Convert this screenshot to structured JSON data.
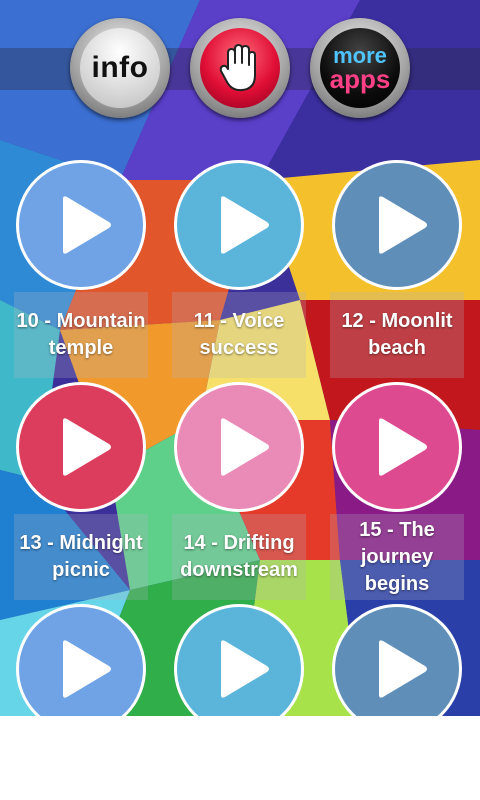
{
  "header": {
    "info_label": "info",
    "hand_icon": "stop-hand-icon",
    "more_line1": "more",
    "more_line2": "apps"
  },
  "tracks": [
    {
      "label": "10 - Mountain temple",
      "color": "#6fa3e6"
    },
    {
      "label": "11 - Voice success",
      "color": "#5bb5db"
    },
    {
      "label": "12 - Moonlit beach",
      "color": "#5f8fb8"
    },
    {
      "label": "13 - Midnight picnic",
      "color": "#dd3d5c"
    },
    {
      "label": "14 - Drifting downstream",
      "color": "#ea8ab7"
    },
    {
      "label": "15 - The journey begins",
      "color": "#dd4a8f"
    },
    {
      "label": "",
      "color": "#6fa3e6"
    },
    {
      "label": "",
      "color": "#5bb5db"
    },
    {
      "label": "",
      "color": "#5f8fb8"
    }
  ]
}
